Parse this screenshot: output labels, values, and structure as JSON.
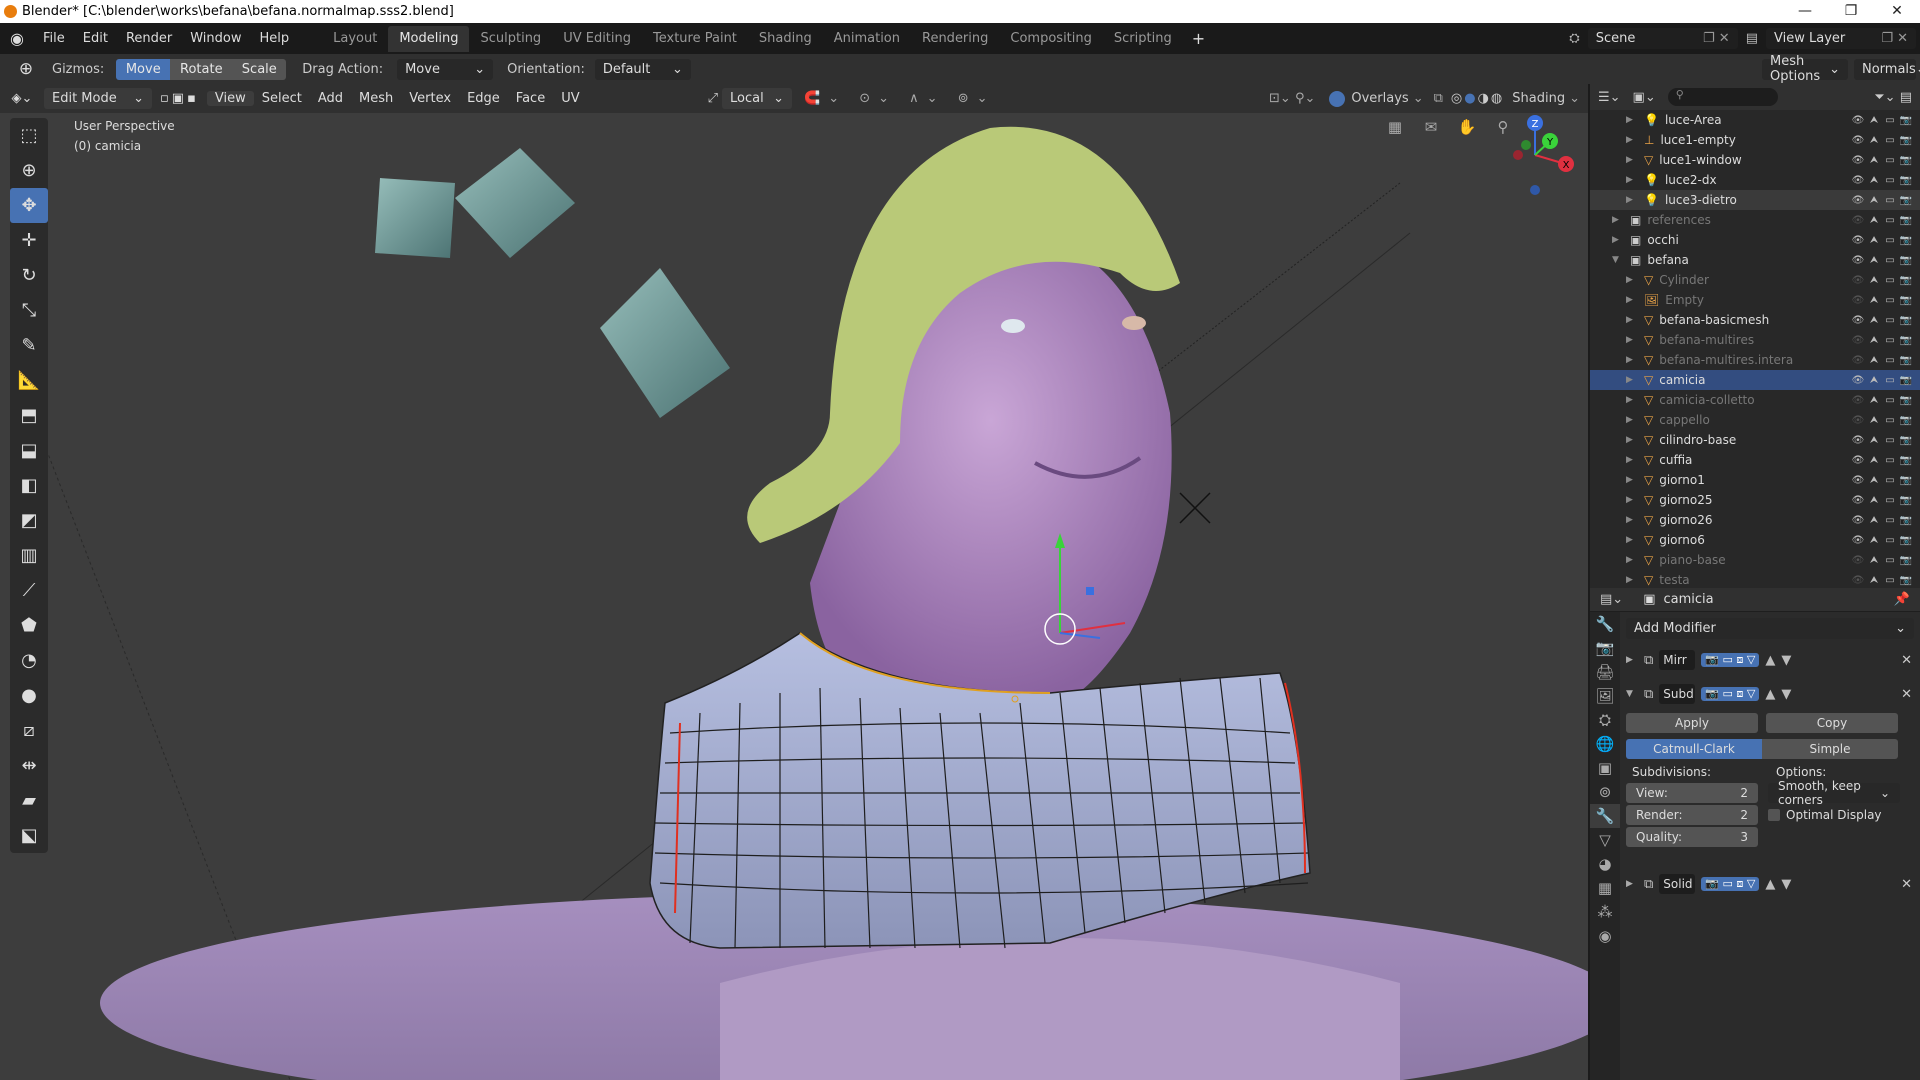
{
  "title_bar": {
    "title": "Blender* [C:\\blender\\works\\befana\\befana.normalmap.sss2.blend]"
  },
  "menu": {
    "items": [
      "File",
      "Edit",
      "Render",
      "Window",
      "Help"
    ]
  },
  "workspaces": {
    "tabs": [
      "Layout",
      "Modeling",
      "Sculpting",
      "UV Editing",
      "Texture Paint",
      "Shading",
      "Animation",
      "Rendering",
      "Compositing",
      "Scripting"
    ],
    "active": "Modeling"
  },
  "scene": {
    "scene_name": "Scene",
    "view_layer": "View Layer"
  },
  "tool_header": {
    "gizmos_label": "Gizmos:",
    "move": "Move",
    "rotate": "Rotate",
    "scale": "Scale",
    "drag_action_label": "Drag Action:",
    "drag_action_value": "Move",
    "orientation_label": "Orientation:",
    "orientation_value": "Default",
    "mesh_options": "Mesh Options",
    "normals": "Normals"
  },
  "viewport_header": {
    "mode": "Edit Mode",
    "menus": [
      "View",
      "Select",
      "Add",
      "Mesh",
      "Vertex",
      "Edge",
      "Face",
      "UV"
    ],
    "transform": "Local",
    "overlays": "Overlays",
    "shading": "Shading"
  },
  "viewport": {
    "perspective": "User Perspective",
    "object": "(0) camicia",
    "axis_x": "X",
    "axis_y": "Y",
    "axis_z": "Z"
  },
  "outliner": {
    "rows": [
      {
        "name": "luce-Area",
        "indent": 2,
        "kind": "light",
        "dim": false,
        "sel": false
      },
      {
        "name": "luce1-empty",
        "indent": 2,
        "kind": "empty",
        "dim": false,
        "sel": false
      },
      {
        "name": "luce1-window",
        "indent": 2,
        "kind": "mesh",
        "dim": false,
        "sel": false
      },
      {
        "name": "luce2-dx",
        "indent": 2,
        "kind": "light",
        "dim": false,
        "sel": false
      },
      {
        "name": "luce3-dietro",
        "indent": 2,
        "kind": "light",
        "dim": false,
        "sel": true
      },
      {
        "name": "references",
        "indent": 1,
        "kind": "collection",
        "dim": true,
        "sel": false
      },
      {
        "name": "occhi",
        "indent": 1,
        "kind": "collection",
        "dim": false,
        "sel": false
      },
      {
        "name": "befana",
        "indent": 1,
        "kind": "collection",
        "dim": false,
        "sel": false
      },
      {
        "name": "Cylinder",
        "indent": 2,
        "kind": "mesh",
        "dim": true,
        "sel": false
      },
      {
        "name": "Empty",
        "indent": 2,
        "kind": "image",
        "dim": true,
        "sel": false
      },
      {
        "name": "befana-basicmesh",
        "indent": 2,
        "kind": "mesh",
        "dim": false,
        "sel": false
      },
      {
        "name": "befana-multires",
        "indent": 2,
        "kind": "mesh",
        "dim": true,
        "sel": false
      },
      {
        "name": "befana-multires.intera",
        "indent": 2,
        "kind": "mesh",
        "dim": true,
        "sel": false
      },
      {
        "name": "camicia",
        "indent": 2,
        "kind": "mesh",
        "dim": false,
        "sel": true,
        "active": true
      },
      {
        "name": "camicia-colletto",
        "indent": 2,
        "kind": "mesh",
        "dim": true,
        "sel": false
      },
      {
        "name": "cappello",
        "indent": 2,
        "kind": "mesh",
        "dim": true,
        "sel": false
      },
      {
        "name": "cilindro-base",
        "indent": 2,
        "kind": "mesh",
        "dim": false,
        "sel": false
      },
      {
        "name": "cuffia",
        "indent": 2,
        "kind": "mesh",
        "dim": false,
        "sel": false
      },
      {
        "name": "giorno1",
        "indent": 2,
        "kind": "mesh",
        "dim": false,
        "sel": false
      },
      {
        "name": "giorno25",
        "indent": 2,
        "kind": "mesh",
        "dim": false,
        "sel": false
      },
      {
        "name": "giorno26",
        "indent": 2,
        "kind": "mesh",
        "dim": false,
        "sel": false
      },
      {
        "name": "giorno6",
        "indent": 2,
        "kind": "mesh",
        "dim": false,
        "sel": false
      },
      {
        "name": "piano-base",
        "indent": 2,
        "kind": "mesh",
        "dim": true,
        "sel": false
      },
      {
        "name": "testa",
        "indent": 2,
        "kind": "mesh",
        "dim": true,
        "sel": false
      }
    ]
  },
  "properties": {
    "object_name": "camicia",
    "add_modifier": "Add Modifier",
    "modifiers": [
      {
        "short": "Mirr",
        "expanded": false
      },
      {
        "short": "Subd",
        "expanded": true
      },
      {
        "short": "Solid",
        "expanded": false
      }
    ],
    "subsurf": {
      "apply": "Apply",
      "copy": "Copy",
      "catmull": "Catmull-Clark",
      "simple": "Simple",
      "subdivisions_label": "Subdivisions:",
      "options_label": "Options:",
      "view_label": "View:",
      "view_value": "2",
      "render_label": "Render:",
      "render_value": "2",
      "quality_label": "Quality:",
      "quality_value": "3",
      "uv_smooth": "Smooth, keep corners",
      "optimal_display": "Optimal Display"
    }
  }
}
